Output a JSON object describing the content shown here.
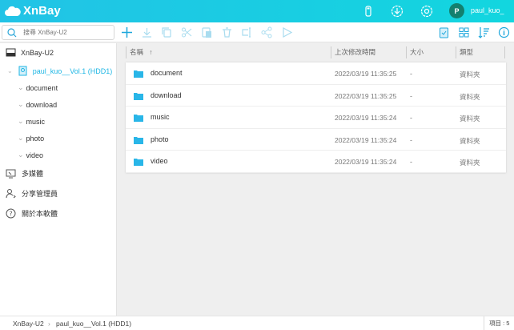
{
  "app": {
    "name": "XnBay",
    "user_initial": "P",
    "user_name": "paul_kuo_"
  },
  "search": {
    "placeholder": "搜尋 XnBay-U2"
  },
  "sidebar": {
    "device": "XnBay-U2",
    "volume": "paul_kuo__Vol.1 (HDD1)",
    "folders": [
      "document",
      "download",
      "music",
      "photo",
      "video"
    ],
    "media": "多媒體",
    "share_admin": "分享管理員",
    "about": "關於本軟體"
  },
  "columns": {
    "name": "名稱",
    "sort": "↑",
    "modified": "上次修改時間",
    "size": "大小",
    "type": "類型"
  },
  "files": [
    {
      "name": "document",
      "modified": "2022/03/19 11:35:25",
      "size": "-",
      "type": "資料夾"
    },
    {
      "name": "download",
      "modified": "2022/03/19 11:35:25",
      "size": "-",
      "type": "資料夾"
    },
    {
      "name": "music",
      "modified": "2022/03/19 11:35:24",
      "size": "-",
      "type": "資料夾"
    },
    {
      "name": "photo",
      "modified": "2022/03/19 11:35:24",
      "size": "-",
      "type": "資料夾"
    },
    {
      "name": "video",
      "modified": "2022/03/19 11:35:24",
      "size": "-",
      "type": "資料夾"
    }
  ],
  "status": {
    "crumb1": "XnBay-U2",
    "sep": "›",
    "crumb2": "paul_kuo__Vol.1 (HDD1)",
    "count": "項目 : 5"
  },
  "colors": {
    "accent": "#1ec8e4",
    "folder": "#29b6e8"
  }
}
